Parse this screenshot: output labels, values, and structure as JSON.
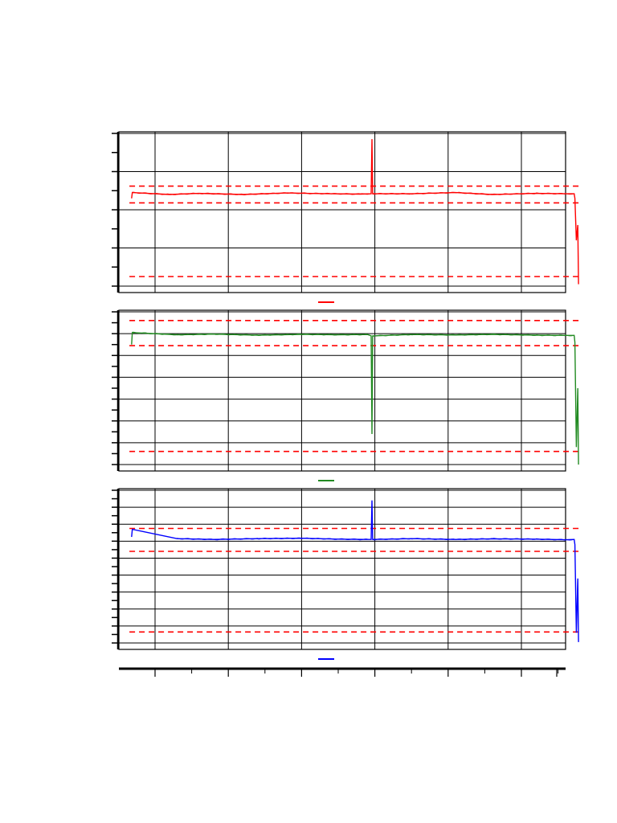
{
  "chart_data": [
    {
      "type": "line",
      "title": "",
      "ylim": [
        0,
        4
      ],
      "xlim": [
        0,
        6
      ],
      "grid": true,
      "legend": "bottom-center",
      "series": [
        {
          "color": "#ff0000",
          "points": [
            [
              -0.32,
              2.3
            ],
            [
              -0.31,
              2.45
            ],
            [
              0.2,
              2.4
            ],
            [
              0.6,
              2.43
            ],
            [
              1.2,
              2.4
            ],
            [
              1.8,
              2.44
            ],
            [
              2.4,
              2.42
            ],
            [
              2.8,
              2.41
            ],
            [
              2.95,
              2.42
            ],
            [
              2.96,
              3.85
            ],
            [
              2.97,
              2.42
            ],
            [
              3.5,
              2.42
            ],
            [
              4.1,
              2.45
            ],
            [
              4.6,
              2.4
            ],
            [
              5.2,
              2.43
            ],
            [
              5.6,
              2.42
            ],
            [
              5.72,
              2.42
            ],
            [
              5.73,
              2.3
            ],
            [
              5.75,
              1.2
            ],
            [
              5.77,
              1.6
            ],
            [
              5.78,
              0.05
            ]
          ]
        }
      ],
      "reference_lines": [
        {
          "y": 2.62,
          "color": "#ff0000",
          "style": "dashed"
        },
        {
          "y": 2.18,
          "color": "#ff0000",
          "style": "dashed"
        },
        {
          "y": 0.25,
          "color": "#ff0000",
          "style": "dashed"
        }
      ]
    },
    {
      "type": "line",
      "title": "",
      "ylim": [
        0,
        7
      ],
      "xlim": [
        0,
        6
      ],
      "grid": true,
      "legend": "bottom-center",
      "series": [
        {
          "color": "#228b22",
          "points": [
            [
              -0.32,
              5.5
            ],
            [
              -0.31,
              6.05
            ],
            [
              0.3,
              5.95
            ],
            [
              0.8,
              5.98
            ],
            [
              1.4,
              5.93
            ],
            [
              2.0,
              5.97
            ],
            [
              2.5,
              5.95
            ],
            [
              2.9,
              5.96
            ],
            [
              2.95,
              5.9
            ],
            [
              2.96,
              1.4
            ],
            [
              2.97,
              5.9
            ],
            [
              3.5,
              5.96
            ],
            [
              4.1,
              5.94
            ],
            [
              4.6,
              5.97
            ],
            [
              5.2,
              5.93
            ],
            [
              5.6,
              5.92
            ],
            [
              5.72,
              5.92
            ],
            [
              5.73,
              5.6
            ],
            [
              5.75,
              0.8
            ],
            [
              5.77,
              3.5
            ],
            [
              5.78,
              0.0
            ]
          ]
        }
      ],
      "reference_lines": [
        {
          "y": 6.6,
          "color": "#ff0000",
          "style": "dashed"
        },
        {
          "y": 5.45,
          "color": "#ff0000",
          "style": "dashed"
        },
        {
          "y": 0.6,
          "color": "#ff0000",
          "style": "dashed"
        }
      ]
    },
    {
      "type": "line",
      "title": "",
      "ylim": [
        0,
        9
      ],
      "xlim": [
        0,
        6
      ],
      "grid": true,
      "legend": "bottom-center",
      "series": [
        {
          "color": "#0000ff",
          "points": [
            [
              -0.32,
              6.25
            ],
            [
              -0.31,
              6.7
            ],
            [
              0.3,
              6.15
            ],
            [
              0.8,
              6.1
            ],
            [
              1.4,
              6.15
            ],
            [
              2.0,
              6.17
            ],
            [
              2.5,
              6.12
            ],
            [
              2.9,
              6.1
            ],
            [
              2.95,
              6.1
            ],
            [
              2.96,
              8.4
            ],
            [
              2.97,
              6.1
            ],
            [
              3.5,
              6.15
            ],
            [
              4.1,
              6.1
            ],
            [
              4.6,
              6.14
            ],
            [
              5.2,
              6.12
            ],
            [
              5.6,
              6.08
            ],
            [
              5.72,
              6.1
            ],
            [
              5.73,
              5.8
            ],
            [
              5.75,
              0.6
            ],
            [
              5.77,
              3.8
            ],
            [
              5.78,
              0.05
            ]
          ]
        }
      ],
      "reference_lines": [
        {
          "y": 6.75,
          "color": "#ff0000",
          "style": "dashed"
        },
        {
          "y": 5.4,
          "color": "#ff0000",
          "style": "dashed"
        },
        {
          "y": 0.65,
          "color": "#ff0000",
          "style": "dashed"
        }
      ]
    }
  ],
  "x_axis": {
    "major_ticks": [
      0,
      1,
      2,
      3,
      4,
      5,
      6
    ],
    "minor_ticks": [
      0.5,
      1.5,
      2.5,
      3.5,
      4.5,
      5.5
    ]
  }
}
